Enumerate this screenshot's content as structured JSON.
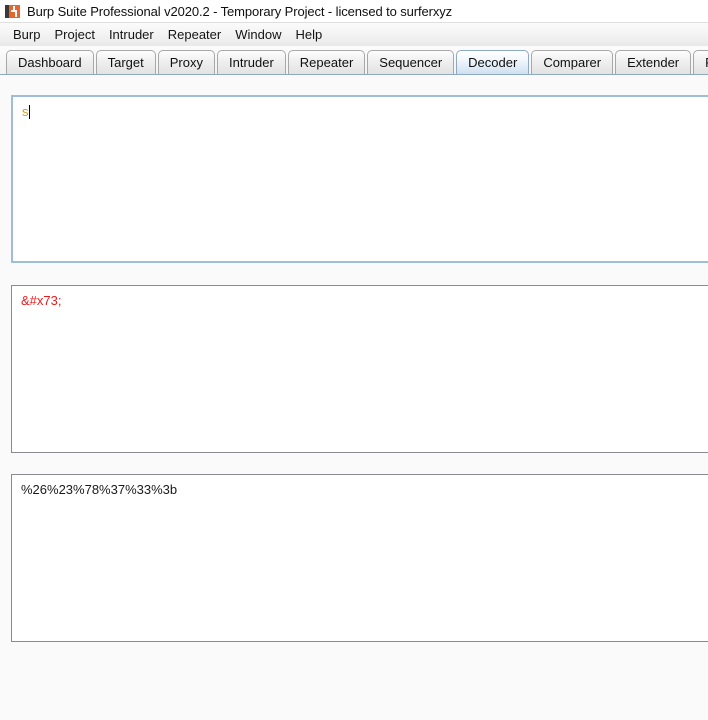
{
  "window": {
    "title": "Burp Suite Professional v2020.2 - Temporary Project - licensed to surferxyz",
    "icon": "burp-suite-icon"
  },
  "menubar": {
    "items": [
      {
        "label": "Burp"
      },
      {
        "label": "Project"
      },
      {
        "label": "Intruder"
      },
      {
        "label": "Repeater"
      },
      {
        "label": "Window"
      },
      {
        "label": "Help"
      }
    ]
  },
  "tabs": {
    "selected": "Decoder",
    "items": [
      {
        "label": "Dashboard"
      },
      {
        "label": "Target"
      },
      {
        "label": "Proxy"
      },
      {
        "label": "Intruder"
      },
      {
        "label": "Repeater"
      },
      {
        "label": "Sequencer"
      },
      {
        "label": "Decoder"
      },
      {
        "label": "Comparer"
      },
      {
        "label": "Extender"
      },
      {
        "label": "Project"
      }
    ]
  },
  "decoder": {
    "input_panel": {
      "value": "s",
      "text_color": "#d39a18"
    },
    "encoded_panel": {
      "value": "&#x73;",
      "text_color": "#e81b1b"
    },
    "output_panel": {
      "value": "%26%23%78%37%33%3b",
      "text_color": "#1a1a1a"
    }
  },
  "colors": {
    "focus_border": "#9dbdd9",
    "panel_border": "#8a8a92",
    "accent": "#e8642a"
  }
}
